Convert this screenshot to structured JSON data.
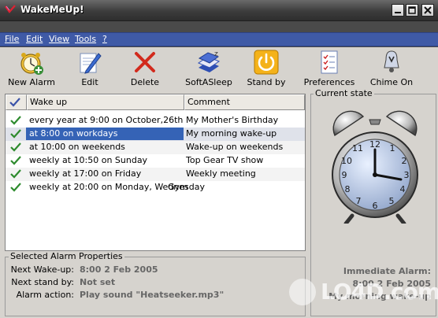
{
  "window": {
    "title": "WakeMeUp!"
  },
  "menu": [
    "File",
    "Edit",
    "View",
    "Tools",
    "?"
  ],
  "toolbar": {
    "new_alarm": "New Alarm",
    "edit": "Edit",
    "delete": "Delete",
    "softasleep": "SoftASleep",
    "standby": "Stand by",
    "preferences": "Preferences",
    "chime_on": "Chime On"
  },
  "alarm_list": {
    "headers": {
      "wakeup": "Wake up",
      "comment": "Comment"
    },
    "rows": [
      {
        "wakeup": "every year at 9:00 on October,26th",
        "comment": "My Mother's Birthday",
        "enabled": true
      },
      {
        "wakeup": "at 8:00 on workdays",
        "comment": "My morning wake-up",
        "enabled": true
      },
      {
        "wakeup": "at 10:00 on weekends",
        "comment": "Wake-up on weekends",
        "enabled": true
      },
      {
        "wakeup": "weekly at 10:50 on Sunday",
        "comment": "Top Gear TV show",
        "enabled": true
      },
      {
        "wakeup": "weekly at 17:00 on Friday",
        "comment": "Weekly meeting",
        "enabled": true
      },
      {
        "wakeup": "weekly at 20:00 on Monday, Wednesday",
        "comment": "Gym",
        "enabled": true
      }
    ],
    "selected_row": 1
  },
  "properties": {
    "title": "Selected Alarm Properties",
    "next_wakeup_label": "Next Wake-up:",
    "next_wakeup_value": "8:00 2 Feb 2005",
    "next_standby_label": "Next stand by:",
    "next_standby_value": "Not set",
    "alarm_action_label": "Alarm action:",
    "alarm_action_value": "Play sound \"Heatseeker.mp3\""
  },
  "current_state": {
    "title": "Current state",
    "immediate_label": "Immediate Alarm:",
    "immediate_time": "8:00 2 Feb 2005",
    "immediate_comment": "My morning wake-up"
  },
  "watermark": "LO4D.com",
  "colors": {
    "menubar": "#3f5aa6",
    "selection": "#3563b6",
    "check": "#2e8b2e"
  }
}
